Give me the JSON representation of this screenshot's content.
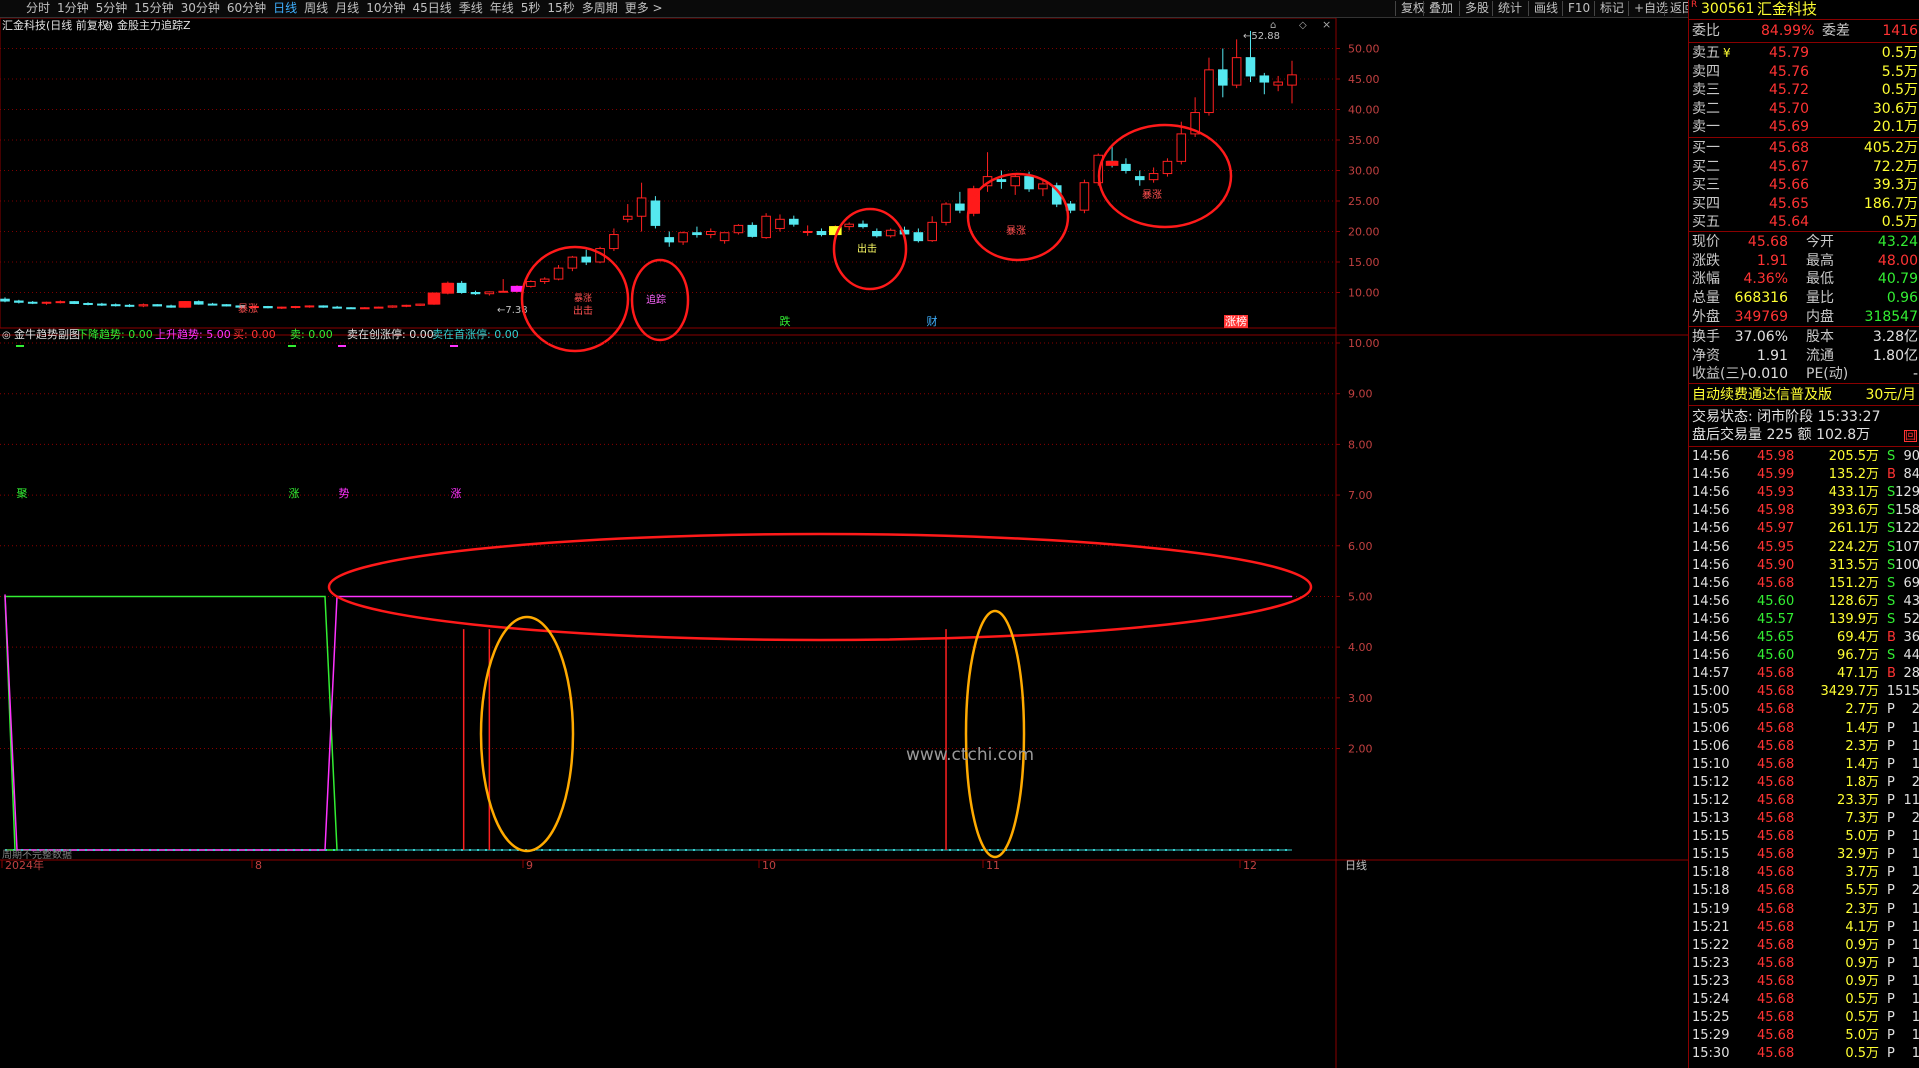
{
  "toolbar": {
    "timeframes": [
      "分时",
      "1分钟",
      "5分钟",
      "15分钟",
      "30分钟",
      "60分钟",
      "日线",
      "周线",
      "月线",
      "10分钟",
      "45日线",
      "季线",
      "年线",
      "5秒",
      "15秒",
      "多周期",
      "更多 >"
    ],
    "active": "日线",
    "right_buttons": [
      "复权",
      "叠加",
      "多股",
      "统计",
      "画线",
      "F10",
      "标记",
      "+自选",
      "返回"
    ]
  },
  "chart_header": {
    "stock_label": "汇金科技(日线 前复权)",
    "indicator_label": "金股主力追踪Z"
  },
  "sub_header": {
    "title": "金牛趋势副图",
    "items": [
      {
        "text": "下降趋势: 0.00",
        "color": "#33ee33"
      },
      {
        "text": "上升趋势: 5.00",
        "color": "#ff33ff"
      },
      {
        "text": "买: 0.00",
        "color": "#ff3333"
      },
      {
        "text": "卖: 0.00",
        "color": "#33ee33"
      },
      {
        "text": "卖在创涨停: 0.00",
        "color": "#e0e0e0"
      },
      {
        "text": "卖在首涨停: 0.00",
        "color": "#33cccc"
      }
    ]
  },
  "main_axis": {
    "labels": [
      "50.00",
      "45.00",
      "40.00",
      "35.00",
      "30.00",
      "25.00",
      "20.00",
      "15.00",
      "10.00"
    ]
  },
  "sub_axis": {
    "labels": [
      "10.00",
      "9.00",
      "8.00",
      "7.00",
      "6.00",
      "5.00",
      "4.00",
      "3.00",
      "2.00"
    ]
  },
  "date_axis": {
    "labels": [
      "2024年",
      "8",
      "9",
      "10",
      "11",
      "12"
    ],
    "bottom_left": "日线"
  },
  "annotations": {
    "low_price": "7.38",
    "high_price": "52.88",
    "candle_labels": [
      "暴涨",
      "出击",
      "追踪",
      "出击",
      "暴涨",
      "暴涨"
    ],
    "event_labels": [
      "跌",
      "财",
      "涨榜"
    ],
    "sub_labels": [
      "聚",
      "涨",
      "势",
      "涨"
    ],
    "no_data_note": "周期不完整数据",
    "watermark": "www.ctchi.com"
  },
  "chart_data": {
    "type": "candlestick",
    "main_ylim": [
      5,
      55
    ],
    "sub_ylim": [
      0,
      10.5
    ],
    "candles": [
      [
        8.9,
        9.2,
        8.4,
        8.6
      ],
      [
        8.6,
        8.8,
        8.2,
        8.4
      ],
      [
        8.4,
        8.6,
        8.1,
        8.3
      ],
      [
        8.3,
        8.5,
        8.0,
        8.4
      ],
      [
        8.4,
        8.7,
        8.2,
        8.5
      ],
      [
        8.5,
        8.6,
        8.1,
        8.2
      ],
      [
        8.2,
        8.4,
        7.9,
        8.1
      ],
      [
        8.1,
        8.3,
        7.8,
        8.0
      ],
      [
        8.0,
        8.2,
        7.7,
        7.9
      ],
      [
        7.9,
        8.1,
        7.6,
        7.8
      ],
      [
        7.8,
        8.2,
        7.6,
        8.0
      ],
      [
        8.0,
        8.1,
        7.7,
        7.8
      ],
      [
        7.8,
        8.0,
        7.5,
        7.6
      ],
      [
        7.6,
        8.6,
        7.5,
        8.5
      ],
      [
        8.5,
        8.7,
        8.0,
        8.1
      ],
      [
        8.1,
        8.3,
        7.9,
        8.0
      ],
      [
        8.0,
        8.1,
        7.7,
        7.8
      ],
      [
        7.8,
        7.9,
        7.5,
        7.6
      ],
      [
        7.6,
        7.8,
        7.4,
        7.7
      ],
      [
        7.7,
        7.8,
        7.4,
        7.5
      ],
      [
        7.5,
        7.7,
        7.3,
        7.6
      ],
      [
        7.6,
        7.8,
        7.4,
        7.7
      ],
      [
        7.7,
        7.9,
        7.5,
        7.8
      ],
      [
        7.8,
        7.9,
        7.5,
        7.6
      ],
      [
        7.6,
        7.8,
        7.4,
        7.5
      ],
      [
        7.5,
        7.6,
        7.3,
        7.4
      ],
      [
        7.4,
        7.6,
        7.3,
        7.5
      ],
      [
        7.5,
        7.7,
        7.38,
        7.6
      ],
      [
        7.6,
        7.9,
        7.5,
        7.8
      ],
      [
        7.8,
        8.0,
        7.6,
        7.9
      ],
      [
        7.9,
        8.2,
        7.8,
        8.1
      ],
      [
        8.1,
        10.0,
        8.0,
        9.9
      ],
      [
        9.9,
        11.8,
        9.7,
        11.5
      ],
      [
        11.5,
        11.9,
        9.8,
        10.0
      ],
      [
        10.0,
        10.3,
        9.6,
        9.8
      ],
      [
        9.8,
        10.2,
        9.5,
        10.1
      ],
      [
        10.1,
        12.2,
        10.0,
        10.2
      ],
      [
        10.2,
        11.2,
        10.0,
        11.0
      ],
      [
        11.0,
        12.0,
        10.8,
        11.8
      ],
      [
        11.8,
        12.5,
        11.4,
        12.2
      ],
      [
        12.2,
        14.5,
        12.0,
        14.0
      ],
      [
        14.0,
        16.0,
        13.5,
        15.8
      ],
      [
        15.8,
        17.0,
        14.5,
        15.0
      ],
      [
        15.0,
        17.5,
        14.8,
        17.2
      ],
      [
        17.2,
        20.5,
        16.8,
        19.5
      ],
      [
        22.0,
        24.5,
        21.5,
        22.5
      ],
      [
        22.5,
        28.0,
        20.0,
        25.5
      ],
      [
        25.0,
        25.8,
        20.5,
        21.0
      ],
      [
        19.0,
        20.0,
        17.5,
        18.3
      ],
      [
        18.3,
        20.0,
        17.8,
        19.8
      ],
      [
        19.8,
        20.8,
        19.0,
        19.5
      ],
      [
        19.5,
        20.5,
        18.9,
        20.0
      ],
      [
        18.5,
        19.5,
        18.0,
        19.8
      ],
      [
        19.8,
        21.2,
        19.5,
        21.0
      ],
      [
        21.0,
        21.5,
        19.0,
        19.2
      ],
      [
        19.0,
        23.0,
        18.8,
        22.5
      ],
      [
        20.5,
        22.8,
        20.0,
        22.0
      ],
      [
        22.0,
        22.6,
        20.8,
        21.2
      ],
      [
        20.0,
        21.0,
        19.3,
        20.0
      ],
      [
        20.0,
        20.5,
        19.2,
        19.5
      ],
      [
        19.5,
        21.0,
        19.0,
        20.8
      ],
      [
        20.8,
        21.5,
        20.2,
        21.2
      ],
      [
        21.2,
        21.8,
        20.5,
        20.8
      ],
      [
        20.0,
        20.5,
        19.0,
        19.3
      ],
      [
        19.3,
        20.5,
        19.0,
        20.2
      ],
      [
        20.2,
        20.8,
        19.4,
        19.6
      ],
      [
        19.8,
        20.5,
        18.2,
        18.5
      ],
      [
        18.5,
        22.5,
        18.3,
        21.5
      ],
      [
        21.5,
        24.8,
        21.0,
        24.5
      ],
      [
        24.5,
        26.5,
        23.0,
        23.5
      ],
      [
        23.0,
        27.5,
        22.5,
        27.0
      ],
      [
        27.5,
        33.0,
        26.5,
        29.0
      ],
      [
        28.5,
        30.0,
        27.0,
        28.2
      ],
      [
        27.5,
        29.5,
        26.0,
        29.0
      ],
      [
        29.0,
        29.8,
        26.5,
        27.0
      ],
      [
        27.0,
        28.5,
        25.8,
        27.8
      ],
      [
        27.5,
        28.0,
        24.0,
        24.5
      ],
      [
        24.5,
        25.0,
        23.0,
        23.5
      ],
      [
        23.5,
        28.5,
        23.0,
        28.0
      ],
      [
        28.0,
        32.8,
        27.5,
        32.5
      ],
      [
        31.5,
        34.0,
        30.5,
        31.0
      ],
      [
        31.0,
        32.0,
        29.5,
        30.0
      ],
      [
        29.0,
        30.0,
        27.5,
        28.5
      ],
      [
        28.5,
        30.5,
        28.0,
        29.5
      ],
      [
        29.5,
        32.0,
        29.0,
        31.5
      ],
      [
        31.5,
        38.0,
        31.0,
        36.0
      ],
      [
        36.0,
        42.0,
        35.5,
        39.5
      ],
      [
        39.5,
        48.5,
        39.0,
        46.5
      ],
      [
        46.5,
        50.0,
        42.0,
        44.0
      ],
      [
        44.0,
        51.5,
        43.5,
        48.5
      ],
      [
        48.5,
        52.88,
        44.5,
        45.5
      ],
      [
        45.5,
        46.0,
        42.5,
        44.5
      ],
      [
        44.0,
        45.5,
        43.0,
        44.5
      ],
      [
        44.0,
        48.0,
        41.0,
        45.68
      ]
    ],
    "signal_x_indices": [
      33,
      35,
      68
    ],
    "ellipses_main": [
      "buy-zone",
      "chase-zone",
      "attack-zone",
      "surge-zone-1",
      "surge-zone-2"
    ]
  },
  "quote": {
    "code": "300561",
    "name": "汇金科技",
    "wb_label": "委比",
    "wb": "84.99%",
    "wc_label": "委差",
    "wc": "1416",
    "asks": [
      {
        "label": "卖五",
        "extra": "¥",
        "price": "45.79",
        "vol": "0.5万"
      },
      {
        "label": "卖四",
        "extra": "",
        "price": "45.76",
        "vol": "5.5万"
      },
      {
        "label": "卖三",
        "extra": "",
        "price": "45.72",
        "vol": "0.5万"
      },
      {
        "label": "卖二",
        "extra": "",
        "price": "45.70",
        "vol": "30.6万"
      },
      {
        "label": "卖一",
        "extra": "",
        "price": "45.69",
        "vol": "20.1万"
      }
    ],
    "bids": [
      {
        "label": "买一",
        "price": "45.68",
        "vol": "405.2万"
      },
      {
        "label": "买二",
        "price": "45.67",
        "vol": "72.2万"
      },
      {
        "label": "买三",
        "price": "45.66",
        "vol": "39.3万"
      },
      {
        "label": "买四",
        "price": "45.65",
        "vol": "186.7万"
      },
      {
        "label": "买五",
        "price": "45.64",
        "vol": "0.5万"
      }
    ],
    "stats": [
      {
        "l1": "现价",
        "v1": "45.68",
        "c1": "#ff3333",
        "l2": "今开",
        "v2": "43.24",
        "c2": "#33ee33"
      },
      {
        "l1": "涨跌",
        "v1": "1.91",
        "c1": "#ff3333",
        "l2": "最高",
        "v2": "48.00",
        "c2": "#ff3333"
      },
      {
        "l1": "涨幅",
        "v1": "4.36%",
        "c1": "#ff3333",
        "l2": "最低",
        "v2": "40.79",
        "c2": "#33ee33"
      },
      {
        "l1": "总量",
        "v1": "668316",
        "c1": "#ffff33",
        "l2": "量比",
        "v2": "0.96",
        "c2": "#33ee33"
      },
      {
        "l1": "外盘",
        "v1": "349769",
        "c1": "#ff3333",
        "l2": "内盘",
        "v2": "318547",
        "c2": "#33ee33"
      }
    ],
    "stats2": [
      {
        "l1": "换手",
        "v1": "37.06%",
        "l2": "股本",
        "v2": "3.28亿"
      },
      {
        "l1": "净资",
        "v1": "1.91",
        "l2": "流通",
        "v2": "1.80亿"
      },
      {
        "l1": "收益(三)",
        "v1": "-0.010",
        "l2": "PE(动)",
        "v2": "-"
      }
    ],
    "promo": "自动续费通达信普及版",
    "promo_price": "30元/月",
    "trade_status": "交易状态: 闭市阶段 15:33:27",
    "after_hours": "盘后交易量 225 额 102.8万"
  },
  "ticks": [
    [
      "14:56",
      "45.98",
      "205.5万",
      "S",
      "90"
    ],
    [
      "14:56",
      "45.99",
      "135.2万",
      "B",
      "84"
    ],
    [
      "14:56",
      "45.93",
      "433.1万",
      "S",
      "129"
    ],
    [
      "14:56",
      "45.98",
      "393.6万",
      "S",
      "158"
    ],
    [
      "14:56",
      "45.97",
      "261.1万",
      "S",
      "122"
    ],
    [
      "14:56",
      "45.95",
      "224.2万",
      "S",
      "107"
    ],
    [
      "14:56",
      "45.90",
      "313.5万",
      "S",
      "100"
    ],
    [
      "14:56",
      "45.68",
      "151.2万",
      "S",
      "69"
    ],
    [
      "14:56",
      "45.60",
      "128.6万",
      "S",
      "43"
    ],
    [
      "14:56",
      "45.57",
      "139.9万",
      "S",
      "52"
    ],
    [
      "14:56",
      "45.65",
      "69.4万",
      "B",
      "36"
    ],
    [
      "14:56",
      "45.60",
      "96.7万",
      "S",
      "44"
    ],
    [
      "14:57",
      "45.68",
      "47.1万",
      "B",
      "28"
    ],
    [
      "15:00",
      "45.68",
      "3429.7万",
      "",
      "1515"
    ],
    [
      "15:05",
      "45.68",
      "2.7万",
      "P",
      "2"
    ],
    [
      "15:06",
      "45.68",
      "1.4万",
      "P",
      "1"
    ],
    [
      "15:06",
      "45.68",
      "2.3万",
      "P",
      "1"
    ],
    [
      "15:10",
      "45.68",
      "1.4万",
      "P",
      "1"
    ],
    [
      "15:12",
      "45.68",
      "1.8万",
      "P",
      "2"
    ],
    [
      "15:12",
      "45.68",
      "23.3万",
      "P",
      "11"
    ],
    [
      "15:13",
      "45.68",
      "7.3万",
      "P",
      "2"
    ],
    [
      "15:15",
      "45.68",
      "5.0万",
      "P",
      "1"
    ],
    [
      "15:15",
      "45.68",
      "32.9万",
      "P",
      "1"
    ],
    [
      "15:18",
      "45.68",
      "3.7万",
      "P",
      "1"
    ],
    [
      "15:18",
      "45.68",
      "5.5万",
      "P",
      "2"
    ],
    [
      "15:19",
      "45.68",
      "2.3万",
      "P",
      "1"
    ],
    [
      "15:21",
      "45.68",
      "4.1万",
      "P",
      "1"
    ],
    [
      "15:22",
      "45.68",
      "0.9万",
      "P",
      "1"
    ],
    [
      "15:23",
      "45.68",
      "0.9万",
      "P",
      "1"
    ],
    [
      "15:23",
      "45.68",
      "0.9万",
      "P",
      "1"
    ],
    [
      "15:24",
      "45.68",
      "0.5万",
      "P",
      "1"
    ],
    [
      "15:25",
      "45.68",
      "0.5万",
      "P",
      "1"
    ],
    [
      "15:29",
      "45.68",
      "5.0万",
      "P",
      "1"
    ],
    [
      "15:30",
      "45.68",
      "0.5万",
      "P",
      "1"
    ]
  ],
  "colors": {
    "up": "#ff2020",
    "down": "#55e8f0",
    "accent": "#3fb0ff",
    "grid": "#8a0000",
    "ellipse": "#ff1a1a",
    "ellipse2": "#ffaa00"
  }
}
